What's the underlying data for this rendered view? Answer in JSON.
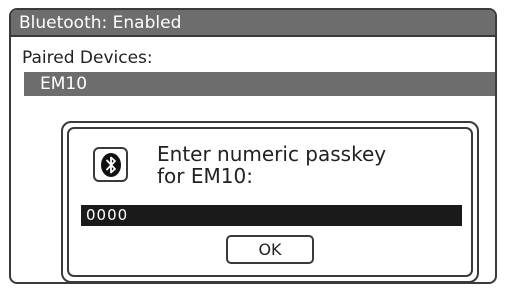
{
  "window": {
    "title": "Bluetooth: Enabled"
  },
  "paired": {
    "label": "Paired Devices:",
    "items": [
      "EM10"
    ]
  },
  "dialog": {
    "icon": "bluetooth-icon",
    "prompt_line1": "Enter numeric passkey",
    "prompt_line2": "for EM10:",
    "passkey_value": "0000",
    "ok_label": "OK"
  },
  "colors": {
    "titlebar": "#6d6d6d",
    "selected_row": "#6d6d6d",
    "passkey_field": "#1a1a1a",
    "border": "#3a3a3a"
  }
}
